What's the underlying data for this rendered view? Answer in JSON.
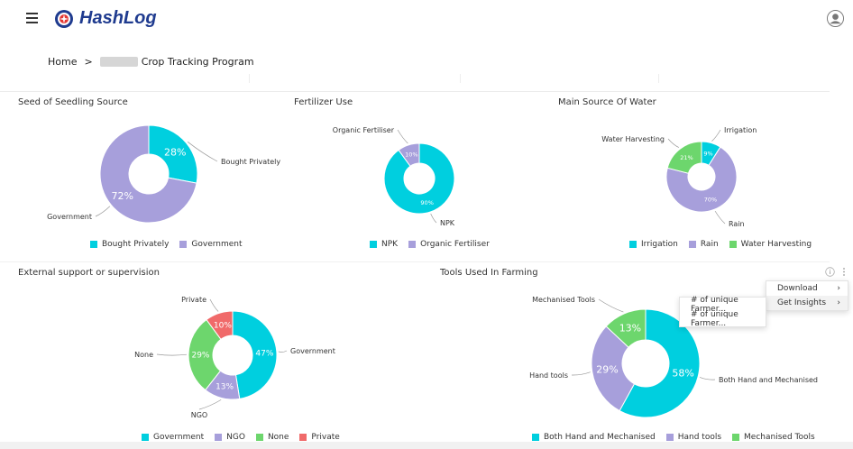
{
  "app": {
    "name": "HashLog"
  },
  "breadcrumb": {
    "home": "Home",
    "separator": ">",
    "current": "Crop Tracking Program"
  },
  "colors": {
    "cyan": "#00CFDF",
    "purple": "#A79FDB",
    "green": "#6DD66D",
    "red": "#F06A6A",
    "brand": "#1F3B8F"
  },
  "panels": {
    "seed": {
      "title": "Seed of Seedling Source"
    },
    "fertilizer": {
      "title": "Fertilizer Use"
    },
    "water": {
      "title": "Main Source Of Water"
    },
    "support": {
      "title": "External support or supervision"
    },
    "tools": {
      "title": "Tools Used In Farming"
    }
  },
  "context_menu": {
    "download": "Download",
    "get_insights": "Get Insights",
    "submenu": [
      "# of unique Farmer...",
      "# of unique Farmer..."
    ]
  },
  "chart_data": [
    {
      "type": "pie",
      "title": "Seed of Seedling Source",
      "categories": [
        "Bought Privately",
        "Government"
      ],
      "values": [
        28,
        72
      ],
      "value_labels": [
        "28%",
        "72%"
      ],
      "colors": [
        "#00CFDF",
        "#A79FDB"
      ],
      "legend": "bottom"
    },
    {
      "type": "pie",
      "title": "Fertilizer Use",
      "categories": [
        "NPK",
        "Organic Fertiliser"
      ],
      "values": [
        90,
        10
      ],
      "value_labels": [
        "90%",
        "10%"
      ],
      "colors": [
        "#00CFDF",
        "#A79FDB"
      ],
      "legend": "bottom"
    },
    {
      "type": "pie",
      "title": "Main Source Of Water",
      "categories": [
        "Irrigation",
        "Rain",
        "Water Harvesting"
      ],
      "values": [
        9,
        70,
        21
      ],
      "value_labels": [
        "9%",
        "70%",
        "21%"
      ],
      "colors": [
        "#00CFDF",
        "#A79FDB",
        "#6DD66D"
      ],
      "legend": "bottom"
    },
    {
      "type": "pie",
      "title": "External support or supervision",
      "categories": [
        "Government",
        "NGO",
        "None",
        "Private"
      ],
      "values": [
        47,
        13,
        29,
        10
      ],
      "value_labels": [
        "47%",
        "13%",
        "29%",
        "10%"
      ],
      "colors": [
        "#00CFDF",
        "#A79FDB",
        "#6DD66D",
        "#F06A6A"
      ],
      "legend": "bottom"
    },
    {
      "type": "pie",
      "title": "Tools Used In Farming",
      "categories": [
        "Both Hand and Mechanised",
        "Hand tools",
        "Mechanised Tools"
      ],
      "values": [
        58,
        29,
        13
      ],
      "value_labels": [
        "58%",
        "29%",
        "13%"
      ],
      "colors": [
        "#00CFDF",
        "#A79FDB",
        "#6DD66D"
      ],
      "legend": "bottom"
    }
  ]
}
